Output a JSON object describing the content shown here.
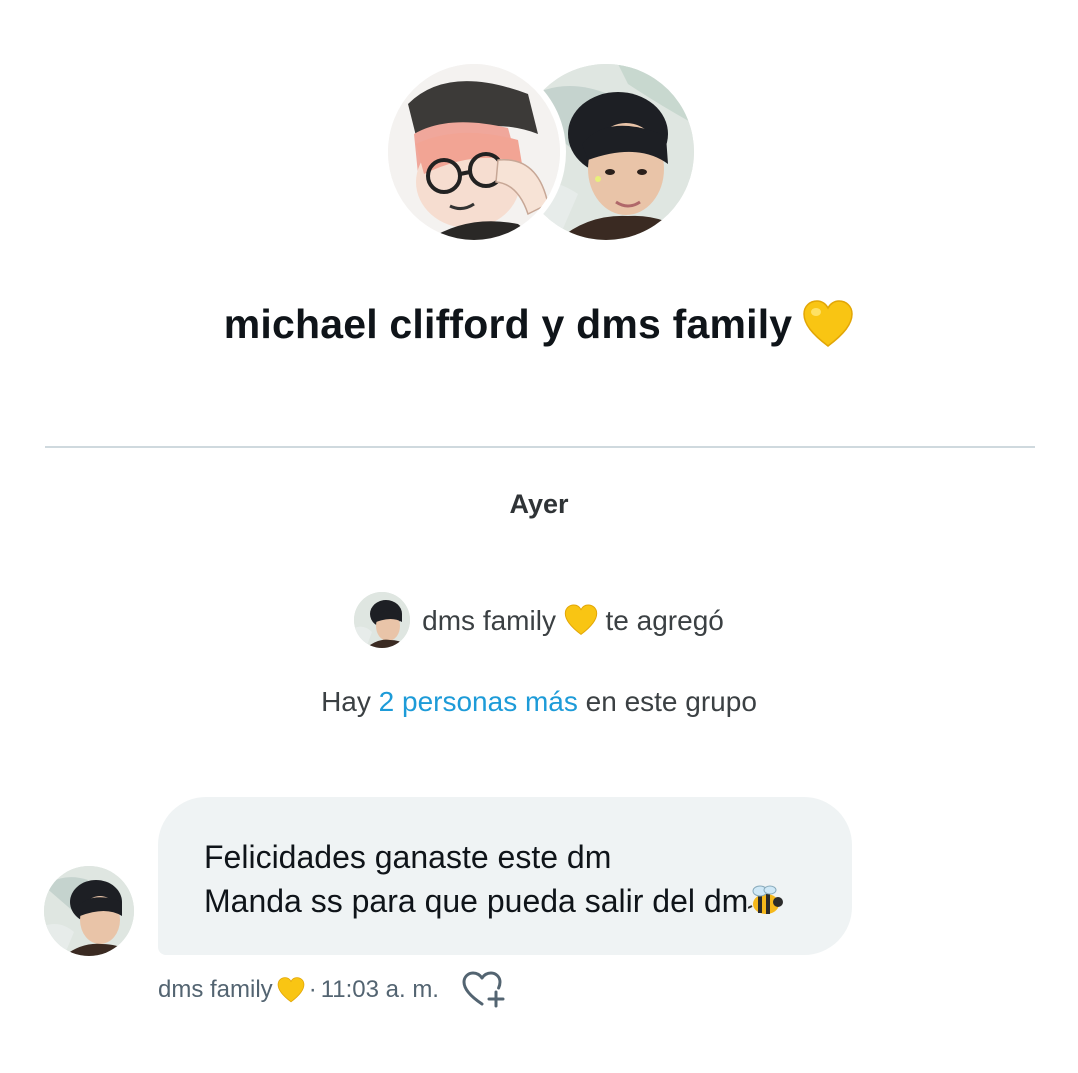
{
  "conversation": {
    "title": "michael clifford y dms family",
    "title_emoji": "yellow-heart-icon",
    "avatars": [
      "anime-boy-avatar",
      "man-portrait-avatar"
    ]
  },
  "timeline": {
    "day_label": "Ayer",
    "event": {
      "actor": "dms family",
      "actor_emoji": "yellow-heart-icon",
      "action": "te agregó"
    },
    "members_note": {
      "prefix": "Hay",
      "link": "2 personas más",
      "suffix": "en este grupo"
    }
  },
  "message": {
    "line1": "Felicidades ganaste este dm",
    "line2": "Manda ss para que pueda salir del dm",
    "line2_emoji": "bee-icon",
    "sender": "dms family",
    "sender_emoji": "yellow-heart-icon",
    "separator": "·",
    "time": "11:03 a. m.",
    "reaction_icon": "heart-plus-icon"
  },
  "colors": {
    "link": "#1d9bd8",
    "bubble": "#eff3f4",
    "divider": "#cfd9de",
    "meta_text": "#536471",
    "heart": "#f9c513"
  }
}
